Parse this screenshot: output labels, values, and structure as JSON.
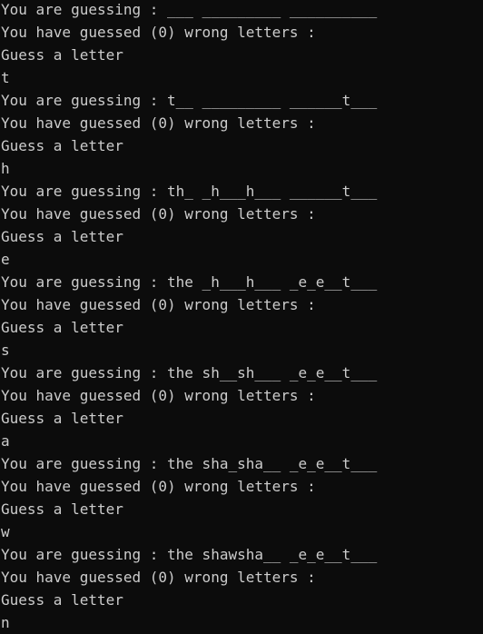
{
  "terminal": {
    "lines": [
      "You are guessing : ___ _________ __________",
      "You have guessed (0) wrong letters :",
      "Guess a letter",
      "t",
      "You are guessing : t__ _________ ______t___",
      "You have guessed (0) wrong letters :",
      "Guess a letter",
      "h",
      "You are guessing : th_ _h___h___ ______t___",
      "You have guessed (0) wrong letters :",
      "Guess a letter",
      "e",
      "You are guessing : the _h___h___ _e_e__t___",
      "You have guessed (0) wrong letters :",
      "Guess a letter",
      "s",
      "You are guessing : the sh__sh___ _e_e__t___",
      "You have guessed (0) wrong letters :",
      "Guess a letter",
      "a",
      "You are guessing : the sha_sha__ _e_e__t___",
      "You have guessed (0) wrong letters :",
      "Guess a letter",
      "w",
      "You are guessing : the shawsha__ _e_e__t___",
      "You have guessed (0) wrong letters :",
      "Guess a letter",
      "n"
    ]
  },
  "colors": {
    "background": "#0c0c0c",
    "text": "#cccccc"
  }
}
